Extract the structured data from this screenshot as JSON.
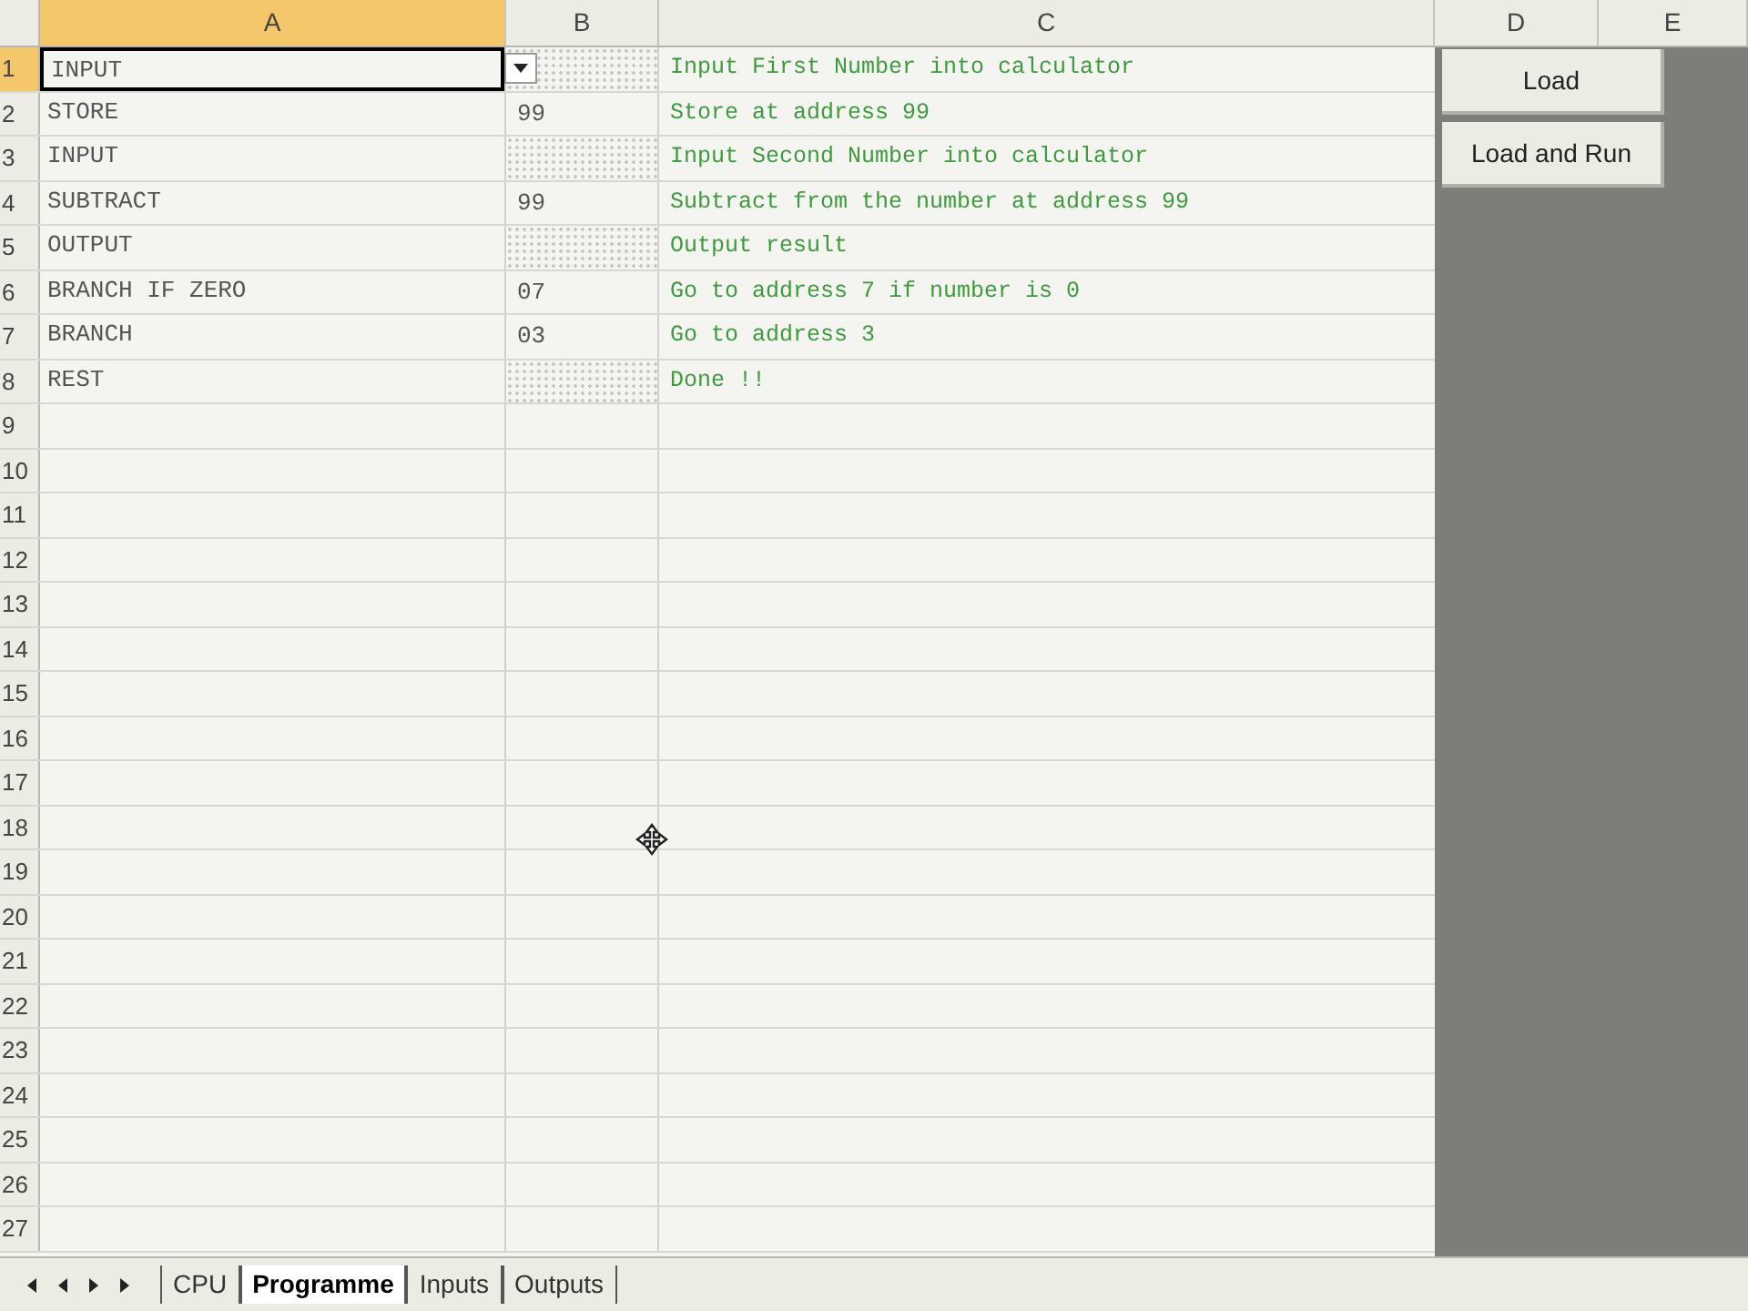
{
  "columns": [
    {
      "label": "A",
      "selected": true
    },
    {
      "label": "B",
      "selected": false
    },
    {
      "label": "C",
      "selected": false
    },
    {
      "label": "D",
      "selected": false
    },
    {
      "label": "E",
      "selected": false
    }
  ],
  "rows": [
    {
      "number": "1",
      "selected": true,
      "a": "INPUT",
      "active": true,
      "hatched": true,
      "c": "Input First Number into calculator"
    },
    {
      "number": "2",
      "selected": false,
      "a": "STORE",
      "active": false,
      "hatched": false,
      "b": "99",
      "c": "Store at address 99"
    },
    {
      "number": "3",
      "selected": false,
      "a": "INPUT",
      "active": false,
      "hatched": true,
      "c": "Input Second Number into calculator"
    },
    {
      "number": "4",
      "selected": false,
      "a": "SUBTRACT",
      "active": false,
      "hatched": false,
      "b": "99",
      "c": "Subtract from the number at address 99"
    },
    {
      "number": "5",
      "selected": false,
      "a": "OUTPUT",
      "active": false,
      "hatched": true,
      "c": "Output result"
    },
    {
      "number": "6",
      "selected": false,
      "a": "BRANCH IF ZERO",
      "active": false,
      "hatched": false,
      "b": "07",
      "c": "Go to address 7 if number is 0"
    },
    {
      "number": "7",
      "selected": false,
      "a": "BRANCH",
      "active": false,
      "hatched": false,
      "b": "03",
      "c": "Go to address 3"
    },
    {
      "number": "8",
      "selected": false,
      "a": "REST",
      "active": false,
      "hatched": true,
      "c": "Done !!"
    },
    {
      "number": "9",
      "selected": false
    },
    {
      "number": "10",
      "selected": false
    },
    {
      "number": "11",
      "selected": false
    },
    {
      "number": "12",
      "selected": false
    },
    {
      "number": "13",
      "selected": false
    },
    {
      "number": "14",
      "selected": false
    },
    {
      "number": "15",
      "selected": false
    },
    {
      "number": "16",
      "selected": false
    },
    {
      "number": "17",
      "selected": false
    },
    {
      "number": "18",
      "selected": false
    },
    {
      "number": "19",
      "selected": false
    },
    {
      "number": "20",
      "selected": false
    },
    {
      "number": "21",
      "selected": false
    },
    {
      "number": "22",
      "selected": false
    },
    {
      "number": "23",
      "selected": false
    },
    {
      "number": "24",
      "selected": false
    },
    {
      "number": "25",
      "selected": false
    },
    {
      "number": "26",
      "selected": false
    },
    {
      "number": "27",
      "selected": false
    }
  ],
  "buttons": [
    "Load",
    "Load and Run"
  ],
  "sheet_tabs": [
    {
      "label": "CPU",
      "selected": false
    },
    {
      "label": "Programme",
      "selected": true
    },
    {
      "label": "Inputs",
      "selected": false
    },
    {
      "label": "Outputs",
      "selected": false
    }
  ]
}
